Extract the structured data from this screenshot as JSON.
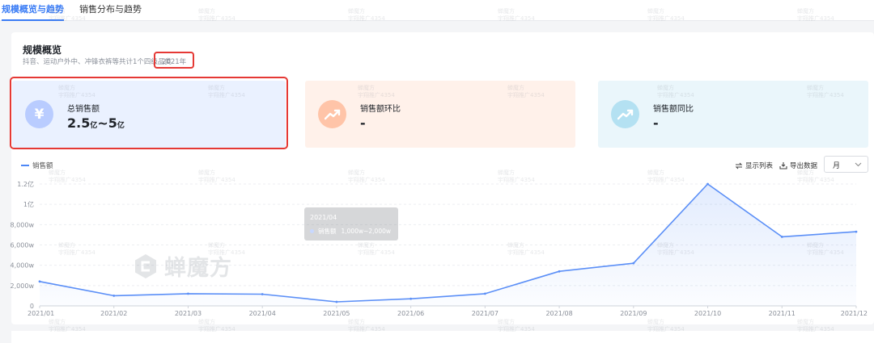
{
  "tabs": [
    {
      "label": "规模概览与趋势",
      "active": true
    },
    {
      "label": "销售分布与趋势",
      "active": false
    }
  ],
  "section": {
    "title": "规模概览",
    "subtitle": "抖音、运动户外中、冲锋衣裤等共计1个四级品类",
    "year_tag": "2021年"
  },
  "kpis": [
    {
      "label": "总销售额",
      "value": "2.5",
      "unit": "亿",
      "value2": "~5",
      "unit2": "亿",
      "icon": "yen-icon"
    },
    {
      "label": "销售额环比",
      "value": "-",
      "icon": "trend-up-icon"
    },
    {
      "label": "销售额同比",
      "value": "-",
      "icon": "trend-up-icon"
    }
  ],
  "toolbar": {
    "show_list": "显示列表",
    "export": "导出数据",
    "period": "月"
  },
  "tooltip": {
    "date": "2021/04",
    "series": "销售额",
    "value": "1,000w~2,000w"
  },
  "logo": {
    "text": "蝉魔方"
  },
  "watermark": {
    "line1": "蝉魔方",
    "line2": "宇翔推广4354"
  },
  "colors": {
    "accent": "#3a7cf5",
    "series": "#4d87f6",
    "highlight": "#e53935"
  },
  "chart_data": {
    "type": "area",
    "series": [
      {
        "name": "销售额",
        "values": [
          2400,
          1000,
          1200,
          1150,
          400,
          700,
          1200,
          3400,
          4200,
          12000,
          6800,
          7300
        ]
      }
    ],
    "categories": [
      "2021/01",
      "2021/02",
      "2021/03",
      "2021/04",
      "2021/05",
      "2021/06",
      "2021/07",
      "2021/08",
      "2021/09",
      "2021/10",
      "2021/11",
      "2021/12"
    ],
    "yticks": [
      "0",
      "2,000w",
      "4,000w",
      "6,000w",
      "8,000w",
      "1亿",
      "1.2亿"
    ],
    "ylim": [
      0,
      12000
    ],
    "unit": "w",
    "legend": "top-left",
    "grid": true
  }
}
